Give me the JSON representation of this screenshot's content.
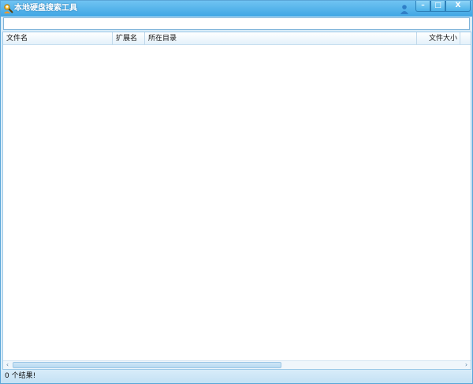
{
  "window": {
    "title": "本地硬盘搜索工具",
    "icons": {
      "app": "search-user-icon",
      "user": "user-icon"
    },
    "controls": {
      "minimize": "–",
      "maximize": "□",
      "close": "X"
    }
  },
  "search": {
    "value": "",
    "placeholder": ""
  },
  "table": {
    "columns": [
      {
        "label": "文件名"
      },
      {
        "label": "扩展名"
      },
      {
        "label": "所在目录"
      },
      {
        "label": "文件大小"
      }
    ],
    "rows": []
  },
  "scrollbar": {
    "left_arrow": "‹",
    "right_arrow": "›"
  },
  "status": {
    "text": "0 个结果!"
  },
  "colors": {
    "titlebar": "#3fa6e4",
    "accent": "#5aa6d8",
    "statusbar": "#c4e1f4"
  }
}
